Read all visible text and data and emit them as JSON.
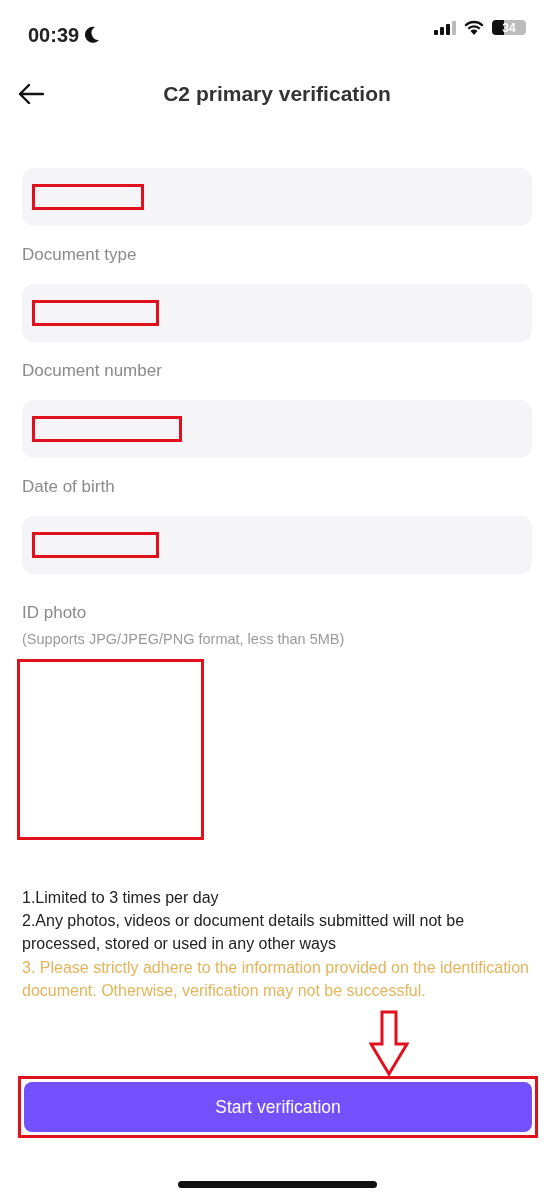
{
  "status_bar": {
    "time": "00:39",
    "battery": "34"
  },
  "header": {
    "title": "C2 primary verification"
  },
  "fields": [
    {
      "redacted": true
    },
    {
      "label": "Document type",
      "redacted": true
    },
    {
      "label": "Document number",
      "redacted": true
    },
    {
      "label": "Date of birth",
      "redacted": true
    }
  ],
  "photo": {
    "label": "ID photo",
    "hint": "(Supports JPG/JPEG/PNG format, less than 5MB)",
    "redacted": true
  },
  "notes": [
    {
      "text": "1.Limited to 3 times per day",
      "kind": "normal"
    },
    {
      "text": "2.Any photos, videos or document details submitted will not be processed, stored or used in any other ways",
      "kind": "normal"
    },
    {
      "text": "3. Please strictly adhere to the information provided on the identification document. Otherwise, verification may not be successful.",
      "kind": "warning"
    }
  ],
  "button": {
    "label": "Start verification",
    "highlighted": true
  }
}
